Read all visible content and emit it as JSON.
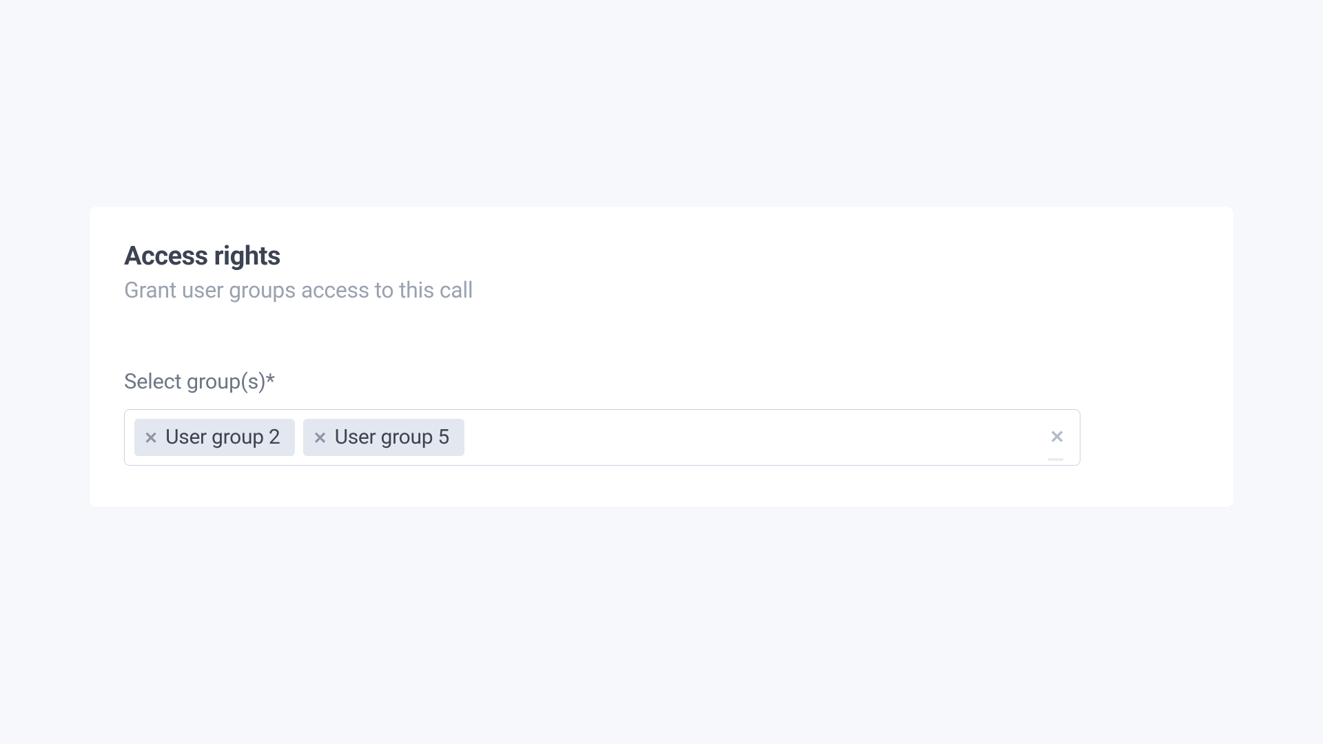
{
  "card": {
    "title": "Access rights",
    "subtitle": "Grant user groups access to this call"
  },
  "field": {
    "label": "Select group(s)*"
  },
  "tags": [
    {
      "label": "User group 2"
    },
    {
      "label": "User group 5"
    }
  ]
}
